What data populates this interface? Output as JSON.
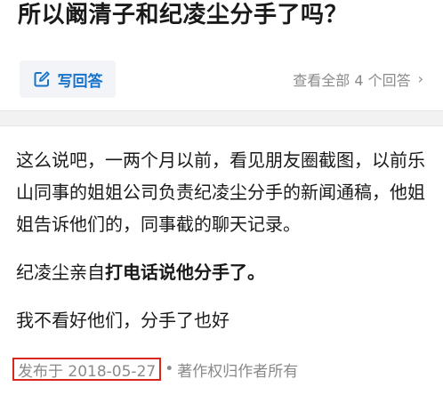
{
  "question": {
    "title": "所以阚清子和纪凌尘分手了吗？"
  },
  "actions": {
    "write_answer_label": "写回答",
    "view_all_label": "查看全部 4 个回答",
    "view_all_chevron": "›"
  },
  "icons": {
    "write_answer_icon": "edit-pencil-square",
    "view_all_icon": "chevron-right"
  },
  "colors": {
    "accent_blue": "#1772c9",
    "highlight_red": "#d6281f",
    "meta_gray": "#8a8a8a"
  },
  "answer": {
    "paragraph1": "这么说吧，一两个月以前，看见朋友圈截图，以前乐山同事的姐姐公司负责纪凌尘分手的新闻通稿，他姐姐告诉他们的，同事截的聊天记录。",
    "paragraph2_prefix": "纪凌尘亲自",
    "paragraph2_bold": "打电话说他分手了。",
    "paragraph3": "我不看好他们，分手了也好",
    "published": "发布于 2018-05-27",
    "separator": "•",
    "copyright": "著作权归作者所有"
  }
}
